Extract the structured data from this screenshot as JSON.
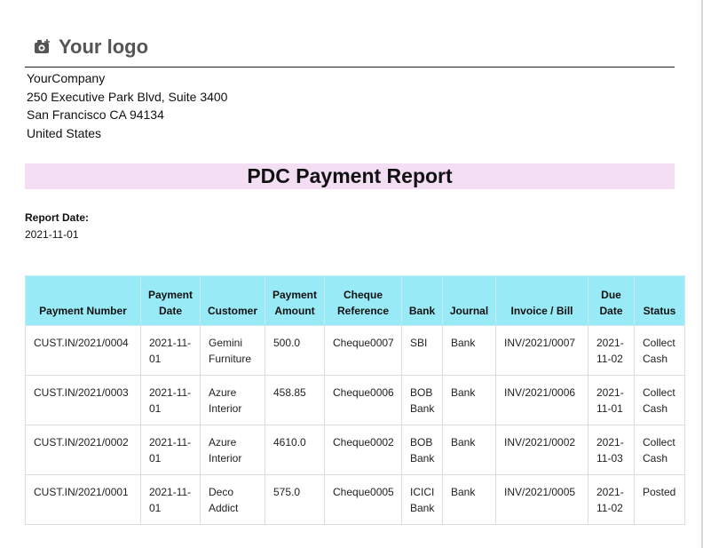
{
  "company": {
    "logo_text": "Your logo",
    "address_lines": [
      "YourCompany",
      "250 Executive Park Blvd, Suite 3400",
      "San Francisco CA 94134",
      "United States"
    ]
  },
  "report": {
    "title": "PDC Payment Report",
    "title_band_color": "#f4def4",
    "header_color": "#97eaf6",
    "date_label": "Report Date:",
    "date_value": "2021-11-01"
  },
  "table": {
    "columns": [
      "Payment Number",
      "Payment Date",
      "Customer",
      "Payment Amount",
      "Cheque Reference",
      "Bank",
      "Journal",
      "Invoice / Bill",
      "Due Date",
      "Status"
    ],
    "rows": [
      [
        "CUST.IN/2021/0004",
        "2021-11-01",
        "Gemini Furniture",
        "500.0",
        "Cheque0007",
        "SBI",
        "Bank",
        "INV/2021/0007",
        "2021-11-02",
        "Collect Cash"
      ],
      [
        "CUST.IN/2021/0003",
        "2021-11-01",
        "Azure Interior",
        "458.85",
        "Cheque0006",
        "BOB Bank",
        "Bank",
        "INV/2021/0006",
        "2021-11-01",
        "Collect Cash"
      ],
      [
        "CUST.IN/2021/0002",
        "2021-11-01",
        "Azure Interior",
        "4610.0",
        "Cheque0002",
        "BOB Bank",
        "Bank",
        "INV/2021/0002",
        "2021-11-03",
        "Collect Cash"
      ],
      [
        "CUST.IN/2021/0001",
        "2021-11-01",
        "Deco Addict",
        "575.0",
        "Cheque0005",
        "ICICI Bank",
        "Bank",
        "INV/2021/0005",
        "2021-11-02",
        "Posted"
      ]
    ]
  }
}
